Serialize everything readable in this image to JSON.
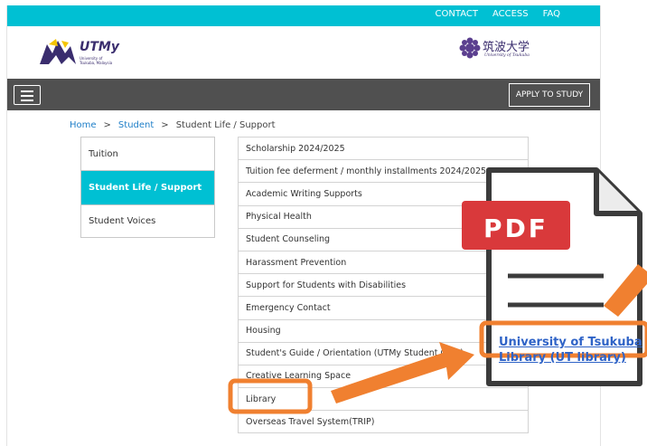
{
  "topbar": {
    "links": [
      "CONTACT",
      "ACCESS",
      "FAQ"
    ]
  },
  "header": {
    "utmy_name": "UTMy",
    "utmy_sub": "University of Tsukuba, Malaysia",
    "tsukuba_kanji": "筑波大学",
    "tsukuba_english": "University of Tsukuba"
  },
  "navbar": {
    "apply_label": "APPLY TO STUDY"
  },
  "breadcrumb": {
    "home": "Home",
    "student": "Student",
    "current": "Student Life / Support",
    "separator": ">"
  },
  "sidemenu": [
    {
      "label": "Tuition"
    },
    {
      "label": "Student Life / Support",
      "active": true
    },
    {
      "label": "Student Voices"
    }
  ],
  "content_list": [
    "Scholarship 2024/2025",
    "Tuition fee deferment / monthly installments 2024/2025",
    "Academic Writing Supports",
    "Physical Health",
    "Student Counseling",
    "Harassment Prevention",
    "Support for Students with Disabilities",
    "Emergency Contact",
    "Housing",
    "Student's Guide / Orientation (UTMy Student Only)",
    "Creative Learning Space",
    "Library",
    "Overseas Travel System(TRIP)"
  ],
  "pdf_callout": {
    "badge": "PDF",
    "link_line1": "University of Tsukuba",
    "link_line2": "Library (UT library)"
  },
  "colors": {
    "accent": "#00c0d3",
    "highlight": "#f08030",
    "pdf_red": "#d9393b",
    "link_blue": "#2f63c7"
  }
}
